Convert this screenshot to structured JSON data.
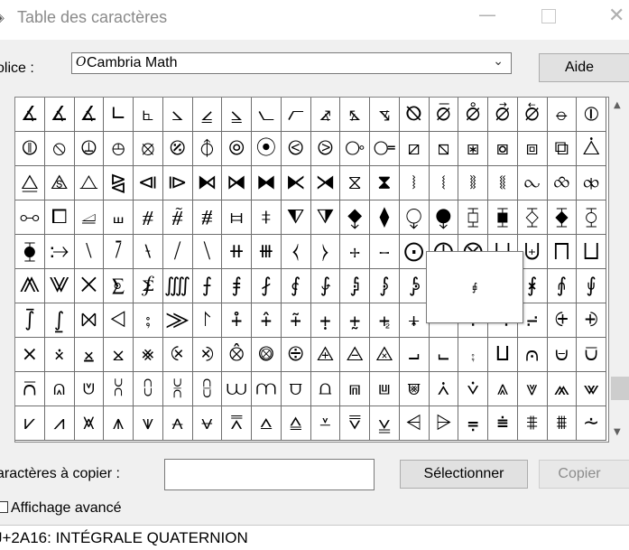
{
  "window": {
    "title": "Table des caractères",
    "minimize": "—",
    "close": "✕"
  },
  "font": {
    "label": "olice :",
    "icon": "O",
    "value": "Cambria Math",
    "dropdown_icon": "chevron-down-icon"
  },
  "buttons": {
    "help": "Aide",
    "select": "Sélectionner",
    "copy": "Copier"
  },
  "grid": {
    "rows": [
      [
        "∡",
        "∡",
        "∡",
        "∟",
        "⦜",
        "⦣",
        "⦤",
        "⦥",
        "⦦",
        "⦧",
        "⦨",
        "⦩",
        "⦪",
        "⦰",
        "⦱",
        "⦲",
        "⦳",
        "⦴",
        "⦵",
        "⦶"
      ],
      [
        "⦷",
        "⦸",
        "⦹",
        "⦺",
        "⦻",
        "⦼",
        "⦽",
        "⦾",
        "⦿",
        "⧀",
        "⧁",
        "⧂",
        "⧃",
        "⧄",
        "⧅",
        "⧆",
        "⧇",
        "⧈",
        "⧉",
        "⧊"
      ],
      [
        "⧋",
        "⧌",
        "⧍",
        "⧎",
        "⧏",
        "⧐",
        "⧑",
        "⧒",
        "⧓",
        "⧔",
        "⧕",
        "⧖",
        "⧗",
        "⧘",
        "⧙",
        "⧚",
        "⧛",
        "⧜",
        "⧝",
        "⧞"
      ],
      [
        "⧟",
        "⧠",
        "⧡",
        "⧢",
        "⧣",
        "⧤",
        "⧥",
        "⧦",
        "⧧",
        "⧨",
        "⧩",
        "⧪",
        "⧫",
        "⧬",
        "⧭",
        "⧮",
        "⧯",
        "⧰",
        "⧱",
        "⧲"
      ],
      [
        "⧳",
        "⧴",
        "⧵",
        "⧶",
        "⧷",
        "⧸",
        "⧹",
        "⧺",
        "⧻",
        "⧼",
        "⧽",
        "⧾",
        "⧿",
        "⨀",
        "⨁",
        "⨂",
        "⨃",
        "⨄",
        "⨅",
        "⨆"
      ],
      [
        "⨇",
        "⨈",
        "⨉",
        "⨊",
        "⨋",
        "⨌",
        "⨍",
        "⨎",
        "⨏",
        "⨐",
        "⨑",
        "⨒",
        "⨓",
        "⨔",
        "⨕",
        "⨖",
        "⨗",
        "⨘",
        "⨙",
        "⨚"
      ],
      [
        "⨛",
        "⨜",
        "⨝",
        "⨞",
        "⨟",
        "⨠",
        "⨡",
        "⨢",
        "⨣",
        "⨤",
        "⨥",
        "⨦",
        "⨧",
        "⨨",
        "⨩",
        "⨪",
        "⨫",
        "⨬",
        "⨭",
        "⨮"
      ],
      [
        "⨯",
        "⨰",
        "⨱",
        "⨲",
        "⨳",
        "⨴",
        "⨵",
        "⨶",
        "⨷",
        "⨸",
        "⨹",
        "⨺",
        "⨻",
        "⨼",
        "⨽",
        "⨾",
        "⨿",
        "⩀",
        "⩁",
        "⩂"
      ],
      [
        "⩃",
        "⩄",
        "⩅",
        "⩆",
        "⩇",
        "⩈",
        "⩉",
        "⩊",
        "⩋",
        "⩌",
        "⩍",
        "⩎",
        "⩏",
        "⩐",
        "⩑",
        "⩒",
        "⩓",
        "⩔",
        "⩕",
        "⩖"
      ],
      [
        "⩗",
        "⩘",
        "⩙",
        "⩚",
        "⩛",
        "⩜",
        "⩝",
        "⩞",
        "⩟",
        "⩠",
        "⩡",
        "⩢",
        "⩣",
        "⩤",
        "⩥",
        "⩦",
        "⩧",
        "⩨",
        "⩩",
        "⩪"
      ]
    ],
    "zoom_glyph": "⨖"
  },
  "copy": {
    "label": "aractères à copier :",
    "value": ""
  },
  "advanced": {
    "label": "Affichage avancé",
    "checked": false
  },
  "status": {
    "text": "J+2A16: INTÉGRALE QUATERNION"
  },
  "scrollbar": {
    "up_icon": "▲",
    "down_icon": "▼"
  }
}
